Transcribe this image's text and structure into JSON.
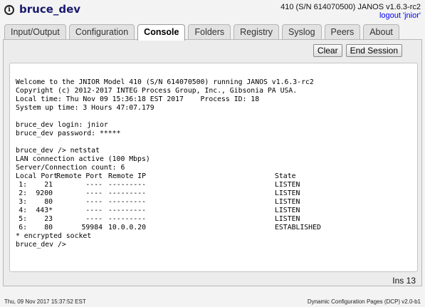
{
  "header": {
    "hostname": "bruce_dev",
    "device_info": "410 (S/N 614070500) JANOS v1.6.3-rc2",
    "logout_label": "logout 'jnior'"
  },
  "tabs": [
    {
      "label": "Input/Output"
    },
    {
      "label": "Configuration"
    },
    {
      "label": "Console"
    },
    {
      "label": "Folders"
    },
    {
      "label": "Registry"
    },
    {
      "label": "Syslog"
    },
    {
      "label": "Peers"
    },
    {
      "label": "About"
    }
  ],
  "active_tab": "Console",
  "toolbar": {
    "clear_label": "Clear",
    "end_session_label": "End Session"
  },
  "console": {
    "intro_lines": [
      "Welcome to the JNIOR Model 410 (S/N 614070500) running JANOS v1.6.3-rc2",
      "Copyright (c) 2012-2017 INTEG Process Group, Inc., Gibsonia PA USA.",
      "Local time: Thu Nov 09 15:36:18 EST 2017    Process ID: 18",
      "System up time: 3 Hours 47:07.179",
      "",
      "bruce_dev login: jnior",
      "bruce_dev password: *****",
      "",
      "bruce_dev /> netstat",
      "LAN connection active (100 Mbps)",
      "Server/Connection count: 6"
    ],
    "netstat_header": {
      "local_port": "Local Port",
      "remote_port": "Remote Port",
      "remote_ip": "Remote IP",
      "state": "State"
    },
    "netstat_rows": [
      {
        "idx": "1:",
        "local_port": "21",
        "remote_port": "----",
        "remote_ip": "---------",
        "state": "LISTEN"
      },
      {
        "idx": "2:",
        "local_port": "9200",
        "remote_port": "----",
        "remote_ip": "---------",
        "state": "LISTEN"
      },
      {
        "idx": "3:",
        "local_port": "80",
        "remote_port": "----",
        "remote_ip": "---------",
        "state": "LISTEN"
      },
      {
        "idx": "4:",
        "local_port": "443*",
        "remote_port": "----",
        "remote_ip": "---------",
        "state": "LISTEN"
      },
      {
        "idx": "5:",
        "local_port": "23",
        "remote_port": "----",
        "remote_ip": "---------",
        "state": "LISTEN"
      },
      {
        "idx": "6:",
        "local_port": "80",
        "remote_port": "59984",
        "remote_ip": "10.0.0.20",
        "state": "ESTABLISHED"
      }
    ],
    "footer_lines": [
      "* encrypted socket",
      "bruce_dev />"
    ]
  },
  "status": {
    "ins_label": "Ins 13"
  },
  "footer": {
    "timestamp": "Thu, 09 Nov 2017 15:37:52 EST",
    "app_info": "Dynamic Configuration Pages (DCP) v2.0-b1"
  },
  "colors": {
    "hostname": "#1a1a6e",
    "link": "#0000ee",
    "background": "#f3f3f3",
    "console_bg": "#ffffff"
  }
}
